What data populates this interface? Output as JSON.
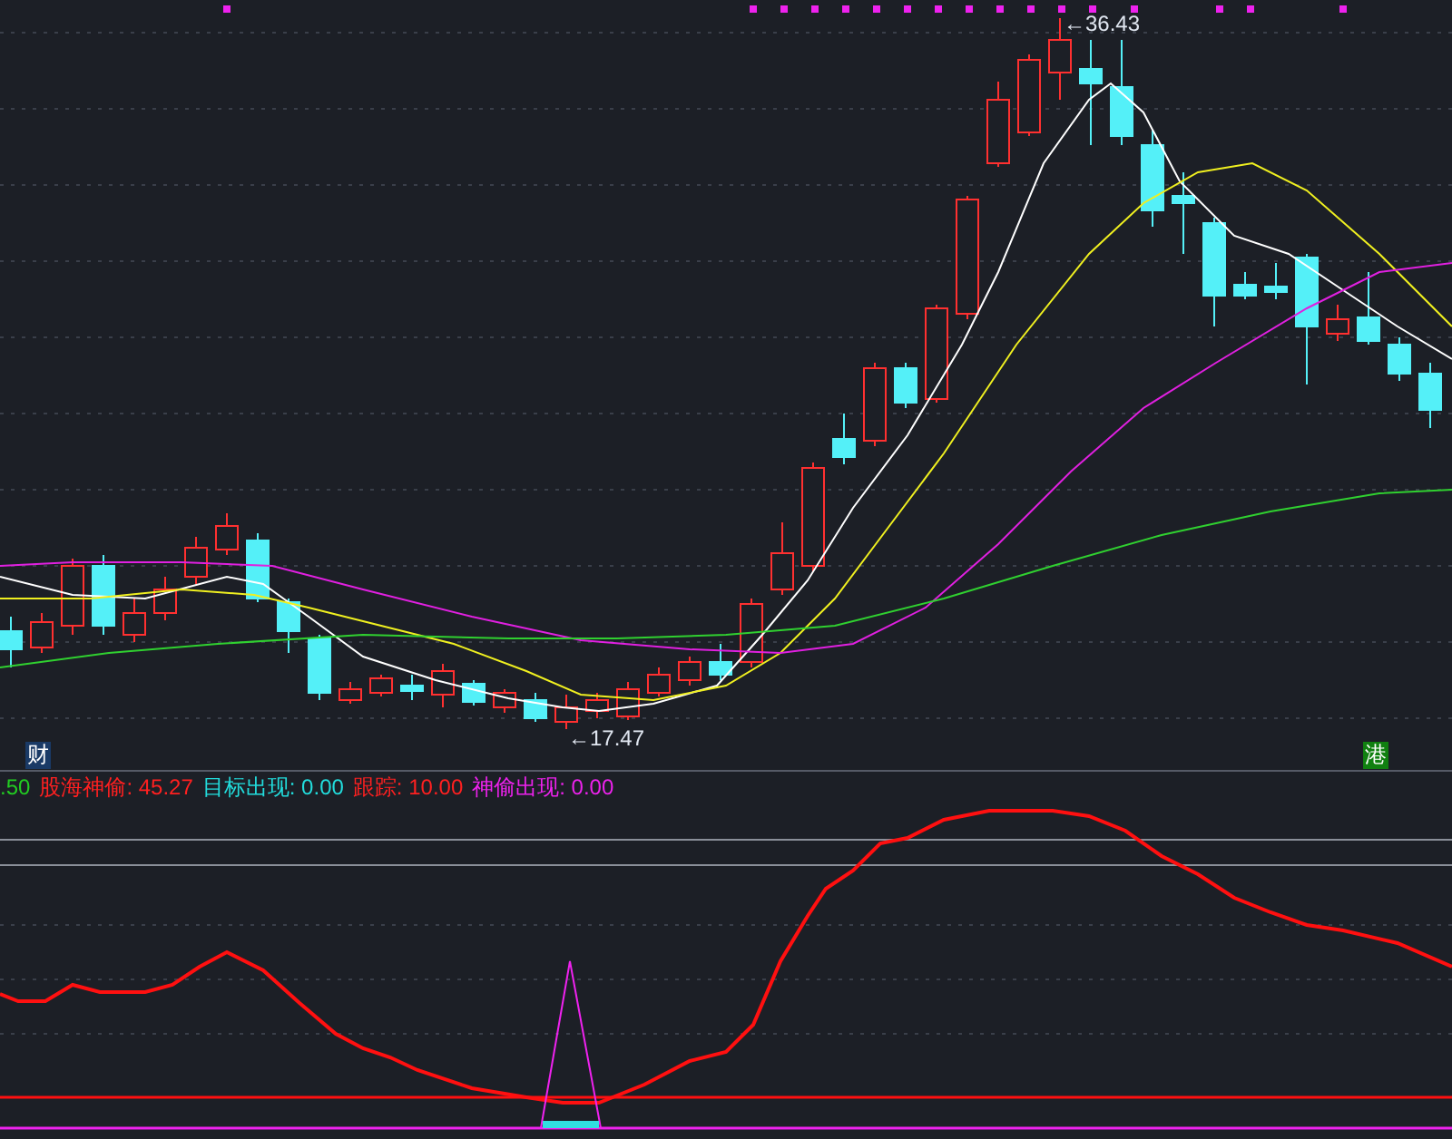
{
  "main_chart": {
    "high_label": "←36.43",
    "low_label": "←17.47",
    "badges": [
      {
        "text": "财",
        "kind": "finance"
      },
      {
        "text": "港",
        "kind": "hk"
      }
    ]
  },
  "indicator_legend": [
    {
      "text": ".50",
      "color": "#22cc22"
    },
    {
      "text": "股海神偷: 45.27",
      "color": "#ff2020"
    },
    {
      "text": "目标出现: 0.00",
      "color": "#22dddd"
    },
    {
      "text": "跟踪: 10.00",
      "color": "#ff2020"
    },
    {
      "text": "神偷出现: 0.00",
      "color": "#ee22ee"
    }
  ]
}
